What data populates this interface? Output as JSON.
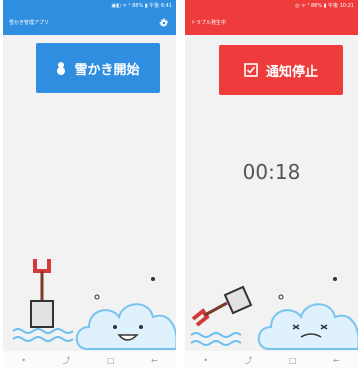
{
  "left": {
    "status": "▣◧ ᯤ ⁴ 88% ▮ 午後 8:41",
    "app_title": "雪かき管理アプリ",
    "button_label": "雪かき開始",
    "nav": [
      "•",
      "⤴",
      "□",
      "←"
    ],
    "colors": {
      "accent": "#2f8ee0"
    }
  },
  "right": {
    "status": "◎ ᯤ ⁴ 88% ▮ 午後 10:21",
    "app_title": "トラブル発生中",
    "button_label": "通知停止",
    "timer": "00:18",
    "nav": [
      "•",
      "⤴",
      "□",
      "←"
    ],
    "colors": {
      "accent": "#ee3b3b"
    }
  }
}
